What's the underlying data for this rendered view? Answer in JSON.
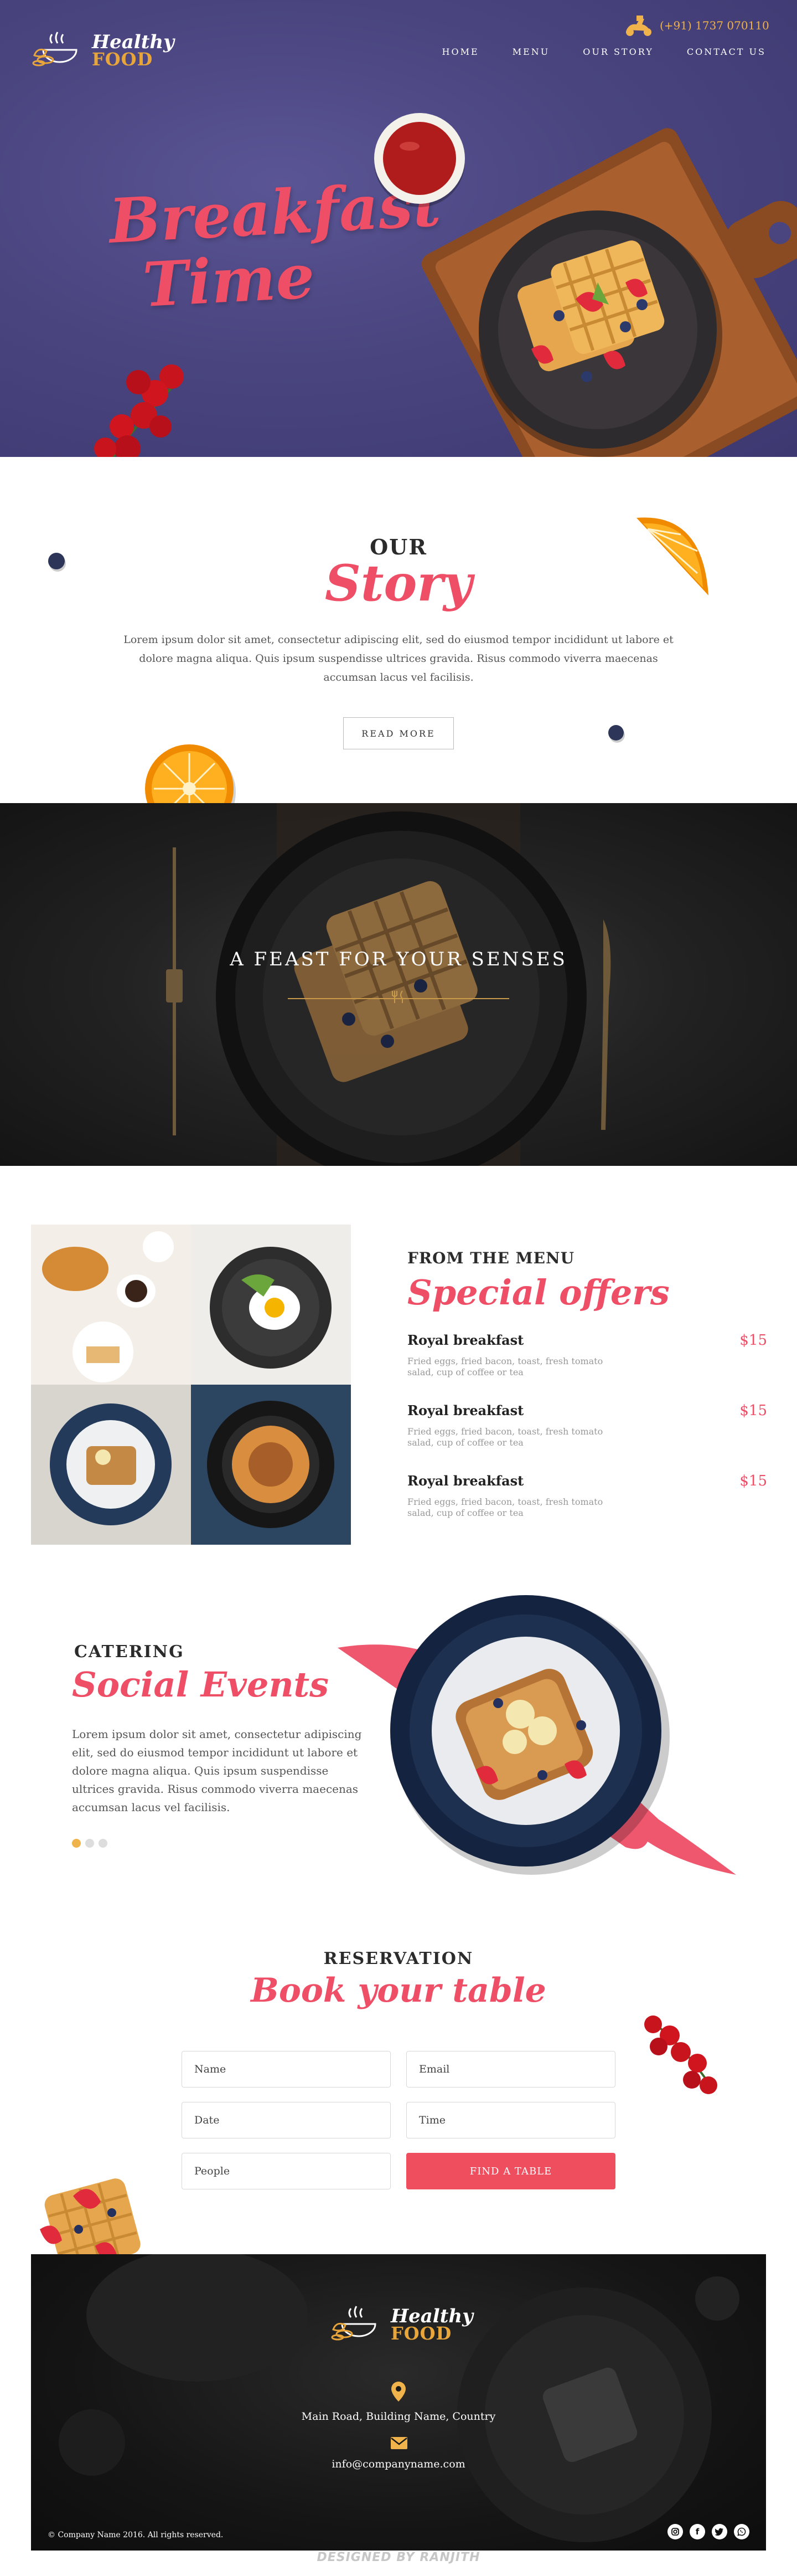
{
  "colors": {
    "brand_red": "#ee4e66",
    "brand_gold": "#e8a53a",
    "hero_bg": "#4a457f",
    "dark_bg": "#1b1b1b"
  },
  "header": {
    "logo_line1": "Healthy",
    "logo_line2": "FOOD",
    "phone": "(+91) 1737 070110",
    "phone_icon": "delivery-scooter-icon",
    "nav": [
      "HOME",
      "MENU",
      "OUR STORY",
      "CONTACT US"
    ]
  },
  "hero": {
    "title_line1": "Breakfast",
    "title_line2": "Time"
  },
  "story": {
    "eyebrow": "OUR",
    "title": "Story",
    "text": "Lorem ipsum dolor sit amet, consectetur adipiscing elit, sed do eiusmod tempor incididunt ut labore et dolore magna aliqua. Quis ipsum suspendisse ultrices gravida. Risus commodo viverra maecenas accumsan lacus vel facilisis.",
    "button": "READ MORE"
  },
  "feast": {
    "heading": "A FEAST FOR YOUR SENSES"
  },
  "menu": {
    "eyebrow": "FROM THE MENU",
    "title": "Special offers",
    "items": [
      {
        "name": "Royal breakfast",
        "price": "$15",
        "desc": "Fried eggs, fried bacon, toast, fresh tomato salad, cup of coffee or tea"
      },
      {
        "name": "Royal breakfast",
        "price": "$15",
        "desc": "Fried eggs, fried bacon, toast, fresh tomato salad, cup of coffee or tea"
      },
      {
        "name": "Royal breakfast",
        "price": "$15",
        "desc": "Fried eggs, fried bacon, toast, fresh tomato salad, cup of coffee or tea"
      }
    ]
  },
  "social": {
    "eyebrow": "CATERING",
    "title": "Social Events",
    "text": "Lorem ipsum dolor sit amet, consectetur adipiscing elit, sed do eiusmod tempor incididunt ut labore et dolore magna aliqua. Quis ipsum suspendisse ultrices gravida. Risus commodo viverra maecenas accumsan lacus vel facilisis.",
    "active_dot": 1,
    "dot_count": 3
  },
  "reservation": {
    "eyebrow": "RESERVATION",
    "title": "Book your table",
    "fields": {
      "name": "Name",
      "email": "Email",
      "date": "Date",
      "time": "Time",
      "people": "People"
    },
    "button": "FIND A TABLE"
  },
  "footer": {
    "logo_line1": "Healthy",
    "logo_line2": "FOOD",
    "address": "Main Road, Building Name, Country",
    "email": "info@companyname.com",
    "copyright": "© Company Name 2016. All rights reserved.",
    "social": [
      "instagram-icon",
      "facebook-icon",
      "twitter-icon",
      "whatsapp-icon"
    ]
  },
  "credit": "DESIGNED BY RANJITH"
}
